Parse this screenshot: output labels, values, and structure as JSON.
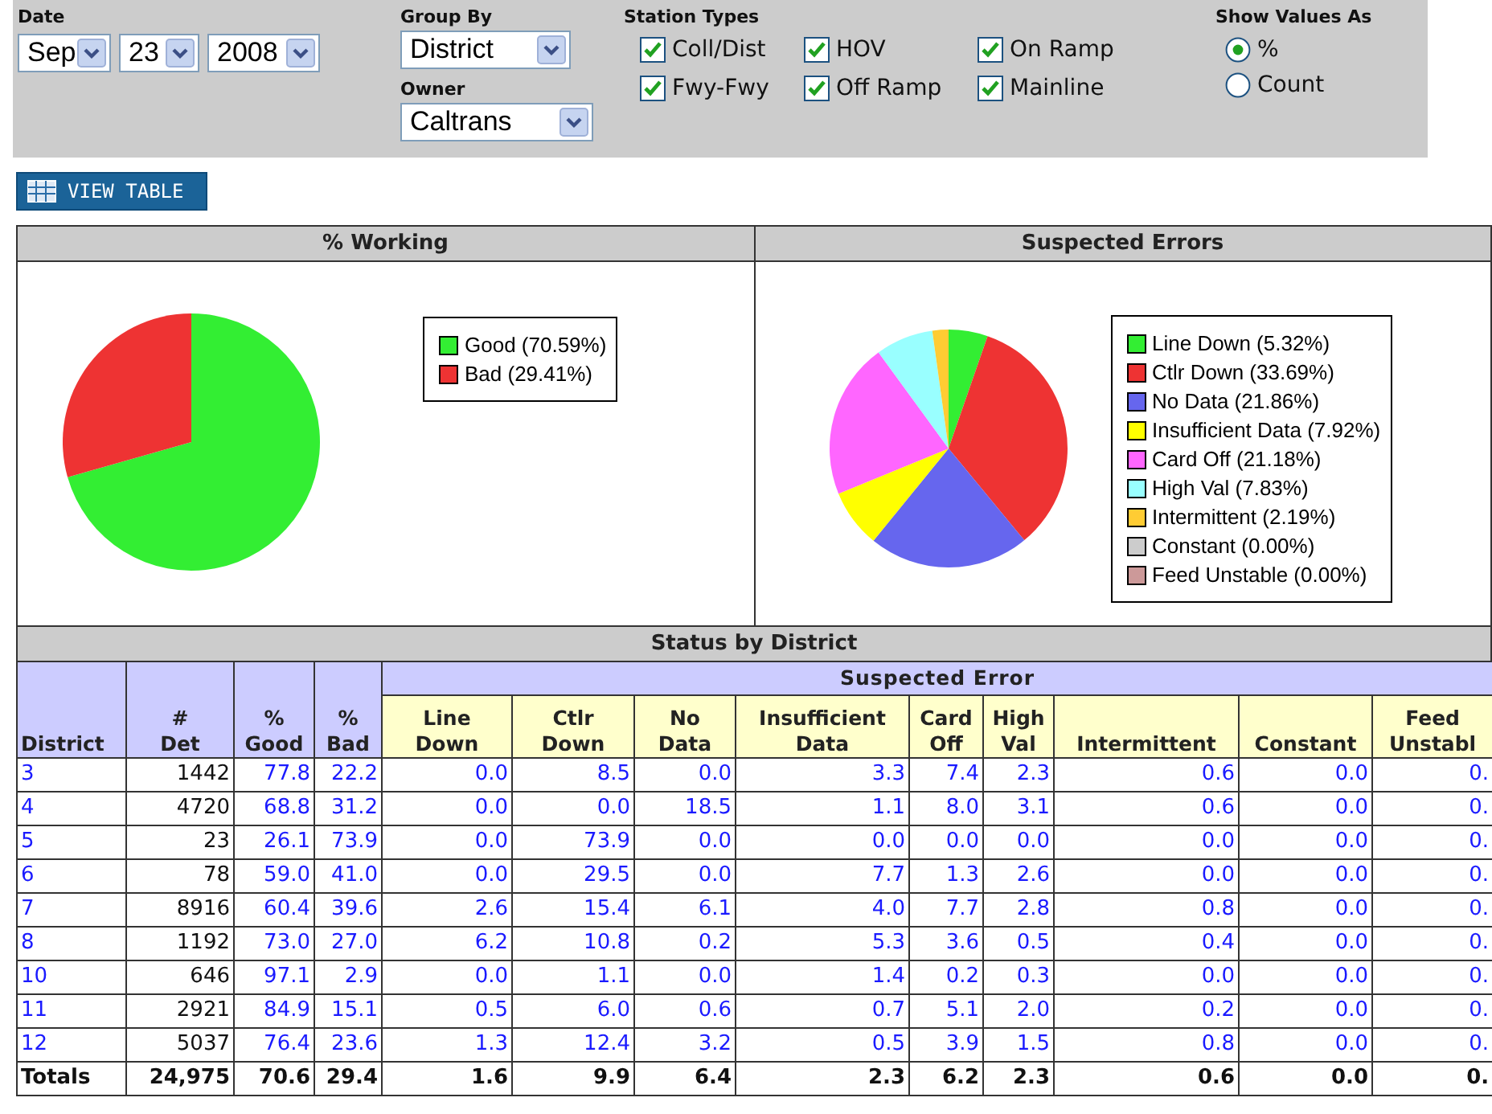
{
  "filters": {
    "date": {
      "label": "Date",
      "month": "Sep",
      "day": "23",
      "year": "2008"
    },
    "group_by": {
      "label": "Group By",
      "value": "District"
    },
    "owner": {
      "label": "Owner",
      "value": "Caltrans"
    },
    "station_types": {
      "label": "Station Types",
      "items": [
        {
          "label": "Coll/Dist",
          "checked": true
        },
        {
          "label": "HOV",
          "checked": true
        },
        {
          "label": "On Ramp",
          "checked": true
        },
        {
          "label": "Fwy-Fwy",
          "checked": true
        },
        {
          "label": "Off Ramp",
          "checked": true
        },
        {
          "label": "Mainline",
          "checked": true
        }
      ]
    },
    "show_values_as": {
      "label": "Show Values As",
      "options": [
        {
          "label": "%",
          "selected": true
        },
        {
          "label": "Count",
          "selected": false
        }
      ]
    }
  },
  "view_table_button": "VIEW TABLE",
  "charts": [
    {
      "title": "% Working",
      "chart_data": {
        "type": "pie",
        "categories": [
          "Good (70.59%)",
          "Bad (29.41%)"
        ],
        "values": [
          70.59,
          29.41
        ],
        "colors": [
          "#33ee33",
          "#ee3333"
        ],
        "legend": "right"
      }
    },
    {
      "title": "Suspected Errors",
      "chart_data": {
        "type": "pie",
        "categories": [
          "Line Down (5.32%)",
          "Ctlr Down (33.69%)",
          "No Data (21.86%)",
          "Insufficient Data (7.92%)",
          "Card Off (21.18%)",
          "High Val (7.83%)",
          "Intermittent (2.19%)",
          "Constant (0.00%)",
          "Feed Unstable (0.00%)"
        ],
        "values": [
          5.32,
          33.69,
          21.86,
          7.92,
          21.18,
          7.83,
          2.19,
          0,
          0
        ],
        "colors": [
          "#33ee33",
          "#ee3333",
          "#6666ee",
          "#ffff00",
          "#ff66ff",
          "#99ffff",
          "#ffcc33",
          "#cccccc",
          "#cc9999"
        ],
        "legend": "right"
      }
    }
  ],
  "table": {
    "title": "Status by District",
    "group_header": "Suspected Error",
    "columns": [
      {
        "label": "District",
        "kind": "district"
      },
      {
        "label": "#\nDet",
        "kind": "count"
      },
      {
        "label": "%\nGood",
        "kind": "share"
      },
      {
        "label": "%\nBad",
        "kind": "share"
      },
      {
        "label": "Line\nDown",
        "kind": "error"
      },
      {
        "label": "Ctlr\nDown",
        "kind": "error"
      },
      {
        "label": "No\nData",
        "kind": "error"
      },
      {
        "label": "Insufficient\nData",
        "kind": "error"
      },
      {
        "label": "Card\nOff",
        "kind": "error"
      },
      {
        "label": "High\nVal",
        "kind": "error"
      },
      {
        "label": "Intermittent",
        "kind": "error"
      },
      {
        "label": "Constant",
        "kind": "error"
      },
      {
        "label": "Feed\nUnstabl",
        "kind": "error"
      }
    ],
    "rows": [
      [
        "3",
        "1442",
        "77.8",
        "22.2",
        "0.0",
        "8.5",
        "0.0",
        "3.3",
        "7.4",
        "2.3",
        "0.6",
        "0.0",
        "0."
      ],
      [
        "4",
        "4720",
        "68.8",
        "31.2",
        "0.0",
        "0.0",
        "18.5",
        "1.1",
        "8.0",
        "3.1",
        "0.6",
        "0.0",
        "0."
      ],
      [
        "5",
        "23",
        "26.1",
        "73.9",
        "0.0",
        "73.9",
        "0.0",
        "0.0",
        "0.0",
        "0.0",
        "0.0",
        "0.0",
        "0."
      ],
      [
        "6",
        "78",
        "59.0",
        "41.0",
        "0.0",
        "29.5",
        "0.0",
        "7.7",
        "1.3",
        "2.6",
        "0.0",
        "0.0",
        "0."
      ],
      [
        "7",
        "8916",
        "60.4",
        "39.6",
        "2.6",
        "15.4",
        "6.1",
        "4.0",
        "7.7",
        "2.8",
        "0.8",
        "0.0",
        "0."
      ],
      [
        "8",
        "1192",
        "73.0",
        "27.0",
        "6.2",
        "10.8",
        "0.2",
        "5.3",
        "3.6",
        "0.5",
        "0.4",
        "0.0",
        "0."
      ],
      [
        "10",
        "646",
        "97.1",
        "2.9",
        "0.0",
        "1.1",
        "0.0",
        "1.4",
        "0.2",
        "0.3",
        "0.0",
        "0.0",
        "0."
      ],
      [
        "11",
        "2921",
        "84.9",
        "15.1",
        "0.5",
        "6.0",
        "0.6",
        "0.7",
        "5.1",
        "2.0",
        "0.2",
        "0.0",
        "0."
      ],
      [
        "12",
        "5037",
        "76.4",
        "23.6",
        "1.3",
        "12.4",
        "3.2",
        "0.5",
        "3.9",
        "1.5",
        "0.8",
        "0.0",
        "0."
      ]
    ],
    "totals": [
      "Totals",
      "24,975",
      "70.6",
      "29.4",
      "1.6",
      "9.9",
      "6.4",
      "2.3",
      "6.2",
      "2.3",
      "0.6",
      "0.0",
      "0."
    ]
  }
}
